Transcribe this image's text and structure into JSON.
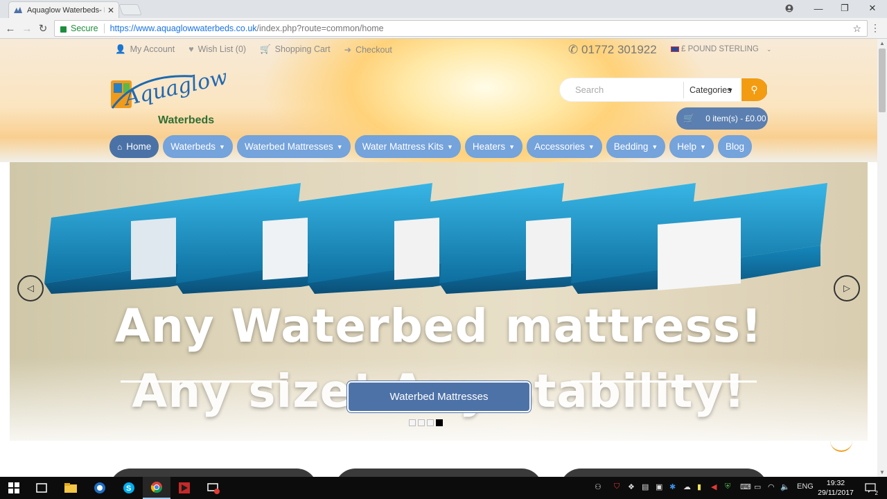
{
  "browser": {
    "tab_title": "Aquaglow Waterbeds- N",
    "secure_label": "Secure",
    "url_host": "https://www.aquaglowwaterbeds.co.uk",
    "url_path": "/index.php?route=common/home"
  },
  "top_links": {
    "account": "My Account",
    "wishlist": "Wish List (0)",
    "cart": "Shopping Cart",
    "checkout": "Checkout"
  },
  "phone": "01772 301922",
  "currency": "£ POUND STERLING",
  "logo": {
    "word": "Aquaglow",
    "sub": "Waterbeds"
  },
  "search": {
    "placeholder": "Search",
    "category": "Categories"
  },
  "cart_button": "0 item(s) - £0.00",
  "nav": [
    {
      "label": "Home"
    },
    {
      "label": "Waterbeds"
    },
    {
      "label": "Waterbed Mattresses"
    },
    {
      "label": "Water Mattress Kits"
    },
    {
      "label": "Heaters"
    },
    {
      "label": "Accessories"
    },
    {
      "label": "Bedding"
    },
    {
      "label": "Help"
    },
    {
      "label": "Blog"
    }
  ],
  "slider": {
    "line1": "Any Waterbed mattress!",
    "line2": "Any size! Any stability!",
    "button": "Waterbed Mattresses",
    "active_slide": 4,
    "slide_count": 4
  },
  "taskbar": {
    "time": "19:32",
    "date": "29/11/2017",
    "lang": "ENG",
    "notifications": "2"
  },
  "colors": {
    "nav_active": "#4a72a6",
    "nav_item": "#75a3db",
    "search_button": "#f39c12",
    "cta": "#4d72a8"
  }
}
